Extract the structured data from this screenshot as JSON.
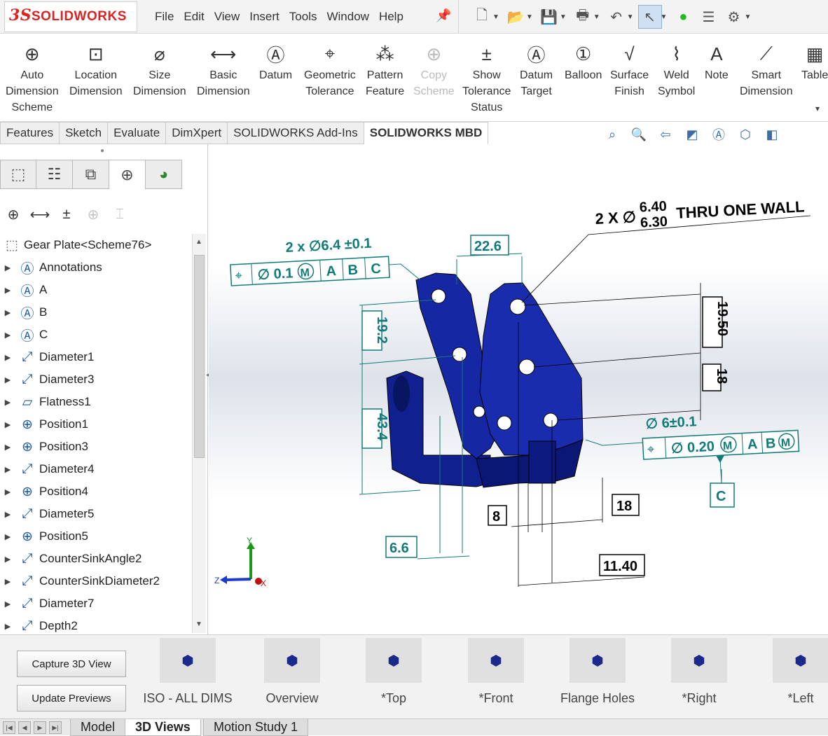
{
  "app": {
    "logo_prefix": "3S",
    "logo_text": "SOLIDWORKS"
  },
  "menu": [
    "File",
    "Edit",
    "View",
    "Insert",
    "Tools",
    "Window",
    "Help"
  ],
  "command_manager": [
    {
      "label": "Auto\nDimension\nScheme",
      "icon": "auto-dimension-icon",
      "glyph": "⊕"
    },
    {
      "label": "Location\nDimension",
      "icon": "location-dimension-icon",
      "glyph": "⊡"
    },
    {
      "label": "Size\nDimension",
      "icon": "size-dimension-icon",
      "glyph": "⌀"
    },
    {
      "label": "Basic\nDimension",
      "icon": "basic-dimension-icon",
      "glyph": "⟷"
    },
    {
      "label": "Datum",
      "icon": "datum-icon",
      "glyph": "Ⓐ"
    },
    {
      "label": "Geometric\nTolerance",
      "icon": "geometric-tolerance-icon",
      "glyph": "⌖"
    },
    {
      "label": "Pattern\nFeature",
      "icon": "pattern-feature-icon",
      "glyph": "⁂"
    },
    {
      "label": "Copy\nScheme",
      "icon": "copy-scheme-icon",
      "glyph": "⊕",
      "disabled": true
    },
    {
      "label": "Show\nTolerance\nStatus",
      "icon": "show-tolerance-icon",
      "glyph": "±"
    },
    {
      "label": "Datum\nTarget",
      "icon": "datum-target-icon",
      "glyph": "Ⓐ"
    },
    {
      "label": "Balloon",
      "icon": "balloon-icon",
      "glyph": "①"
    },
    {
      "label": "Surface\nFinish",
      "icon": "surface-finish-icon",
      "glyph": "√"
    },
    {
      "label": "Weld\nSymbol",
      "icon": "weld-symbol-icon",
      "glyph": "⌇"
    },
    {
      "label": "Note",
      "icon": "note-icon",
      "glyph": "A"
    },
    {
      "label": "Smart\nDimension",
      "icon": "smart-dimension-icon",
      "glyph": "⟋"
    },
    {
      "label": "Table",
      "icon": "table-icon",
      "glyph": "▦"
    }
  ],
  "tabs": [
    "Features",
    "Sketch",
    "Evaluate",
    "DimXpert",
    "SOLIDWORKS Add-Ins",
    "SOLIDWORKS MBD"
  ],
  "active_tab": "SOLIDWORKS MBD",
  "tree": {
    "root": "Gear Plate<Scheme76>",
    "items": [
      {
        "label": "Annotations",
        "icon": "annotations-icon",
        "glyph": "Ⓐ"
      },
      {
        "label": "A",
        "icon": "datum-icon",
        "glyph": "Ⓐ"
      },
      {
        "label": "B",
        "icon": "datum-icon",
        "glyph": "Ⓐ"
      },
      {
        "label": "C",
        "icon": "datum-icon",
        "glyph": "Ⓐ"
      },
      {
        "label": "Diameter1",
        "icon": "diameter-icon",
        "glyph": "⤢"
      },
      {
        "label": "Diameter3",
        "icon": "diameter-icon",
        "glyph": "⤢"
      },
      {
        "label": "Flatness1",
        "icon": "flatness-icon",
        "glyph": "▱"
      },
      {
        "label": "Position1",
        "icon": "position-icon",
        "glyph": "⊕"
      },
      {
        "label": "Position3",
        "icon": "position-icon",
        "glyph": "⊕"
      },
      {
        "label": "Diameter4",
        "icon": "diameter-icon",
        "glyph": "⤢"
      },
      {
        "label": "Position4",
        "icon": "position-icon",
        "glyph": "⊕"
      },
      {
        "label": "Diameter5",
        "icon": "diameter-icon",
        "glyph": "⤢"
      },
      {
        "label": "Position5",
        "icon": "position-icon",
        "glyph": "⊕"
      },
      {
        "label": "CounterSinkAngle2",
        "icon": "diameter-icon",
        "glyph": "⤢"
      },
      {
        "label": "CounterSinkDiameter2",
        "icon": "diameter-icon",
        "glyph": "⤢"
      },
      {
        "label": "Diameter7",
        "icon": "diameter-icon",
        "glyph": "⤢"
      },
      {
        "label": "Depth2",
        "icon": "diameter-icon",
        "glyph": "⤢"
      }
    ]
  },
  "annotations": {
    "hole_callout_left": "2 x ∅6.4 ±0.1",
    "fcf_left": {
      "tol": "∅ 0.1",
      "mod": "M",
      "datums": [
        "A",
        "B",
        "C"
      ]
    },
    "thru_callout_prefix": "2 X ∅",
    "thru_upper": "6.40",
    "thru_lower": "6.30",
    "thru_suffix": "THRU ONE WALL",
    "dim_22_6": "22.6",
    "dim_19_2": "19.2",
    "dim_43_4": "43.4",
    "dim_6_6": "6.6",
    "dim_19_50": "19.50",
    "dim_18_v": "18",
    "hole_callout_right": "∅ 6±0.1",
    "fcf_right": {
      "tol": "∅ 0.20",
      "mod": "M",
      "datums": [
        "A",
        "B"
      ],
      "datum_mod": "M"
    },
    "datum_c": "C",
    "dim_8": "8",
    "dim_18_h": "18",
    "dim_11_40": "11.40",
    "triad": {
      "x": "X",
      "y": "Y",
      "z": "Z"
    }
  },
  "bottom": {
    "capture_button": "Capture 3D View",
    "update_button": "Update Previews",
    "views": [
      "ISO - ALL DIMS",
      "Overview",
      "*Top",
      "*Front",
      "Flange Holes",
      "*Right",
      "*Left"
    ]
  },
  "status_tabs": [
    "Model",
    "3D Views",
    "Motion Study 1"
  ],
  "active_status_tab": "3D Views",
  "colors": {
    "annotation": "#127a78",
    "part": "#0e1f8a",
    "logo": "#dd2222"
  }
}
